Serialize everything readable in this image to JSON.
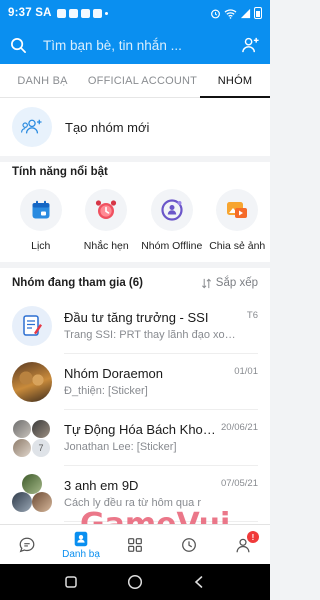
{
  "status_bar": {
    "time": "9:37 SA"
  },
  "search": {
    "placeholder": "Tìm bạn bè, tin nhắn ..."
  },
  "tabs": [
    {
      "label": "DANH BẠ",
      "active": false
    },
    {
      "label": "OFFICIAL ACCOUNT",
      "active": false
    },
    {
      "label": "NHÓM",
      "active": true
    }
  ],
  "create_group": {
    "label": "Tạo nhóm mới"
  },
  "features": {
    "title": "Tính năng nổi bật",
    "items": [
      {
        "label": "Lịch",
        "icon": "calendar-icon"
      },
      {
        "label": "Nhắc hẹn",
        "icon": "alarm-clock-icon"
      },
      {
        "label": "Nhóm Offline",
        "icon": "offline-group-icon"
      },
      {
        "label": "Chia sẻ ảnh",
        "icon": "share-photo-icon"
      }
    ]
  },
  "groups": {
    "title": "Nhóm đang tham gia (6)",
    "sort_label": "Sắp xếp",
    "items": [
      {
        "name": "Đầu tư tăng trưởng - SSI",
        "preview": "Trang SSI: PRT thay lãnh đạo xong lợi...",
        "time": "T6"
      },
      {
        "name": "Nhóm Doraemon",
        "preview": "Đ_thiện: [Sticker]",
        "time": "01/01"
      },
      {
        "name": "Tự Động Hóa Bách Khoa...",
        "preview": "Jonathan Lee: [Sticker]",
        "time": "20/06/21",
        "member_count": "7"
      },
      {
        "name": "3 anh em 9D",
        "preview": "Cách ly đều ra từ hôm qua r",
        "time": "07/05/21"
      }
    ]
  },
  "bottom_nav": [
    {
      "label": "",
      "icon": "messages-icon"
    },
    {
      "label": "Danh bạ",
      "icon": "contacts-icon",
      "active": true
    },
    {
      "label": "",
      "icon": "discover-grid-icon"
    },
    {
      "label": "",
      "icon": "timeline-clock-icon"
    },
    {
      "label": "",
      "icon": "profile-icon",
      "badge": "!"
    }
  ],
  "watermark": {
    "brand": "GameVui",
    "tagline": "Cùng chơi cùng vui"
  },
  "colors": {
    "primary": "#0a8ff0",
    "badge": "#f03a3a",
    "muted": "#888b90"
  }
}
